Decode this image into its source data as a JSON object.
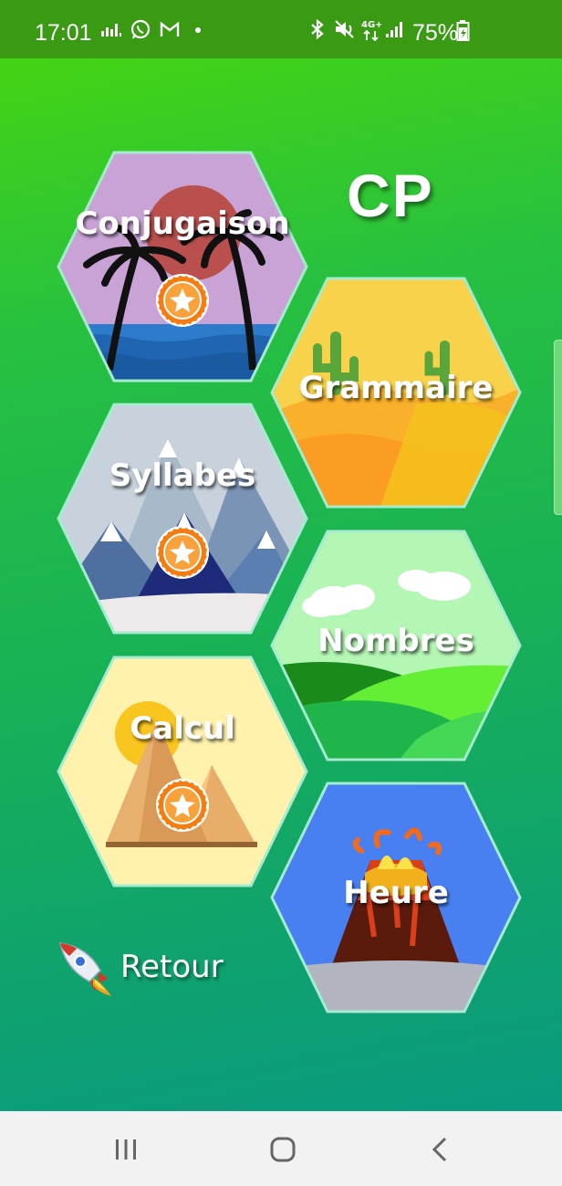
{
  "status_bar": {
    "time": "17:01",
    "battery": "75%",
    "left_icons": [
      "activity-icon",
      "whatsapp-icon",
      "gmail-icon",
      "dot-icon"
    ],
    "right_icons": [
      "bluetooth-icon",
      "mute-icon",
      "4g-signal-icon",
      "signal-bars-icon",
      "battery-charging-icon"
    ]
  },
  "title": "CP",
  "tiles": [
    {
      "label": "Conjugaison",
      "star": true
    },
    {
      "label": "Grammaire",
      "star": false
    },
    {
      "label": "Syllabes",
      "star": true
    },
    {
      "label": "Nombres",
      "star": false
    },
    {
      "label": "Calcul",
      "star": true
    },
    {
      "label": "Heure",
      "star": false
    }
  ],
  "back_label": "Retour",
  "colors": {
    "status_bar": "#3a9a14",
    "gradient_top": "#44d414",
    "gradient_bottom": "#0a9a80",
    "hex_border": "#a6ead0",
    "badge_orange": "#f57c10",
    "navbar": "#f2f2f2"
  },
  "nav_bar": [
    "recent-apps-icon",
    "home-icon",
    "back-icon"
  ]
}
